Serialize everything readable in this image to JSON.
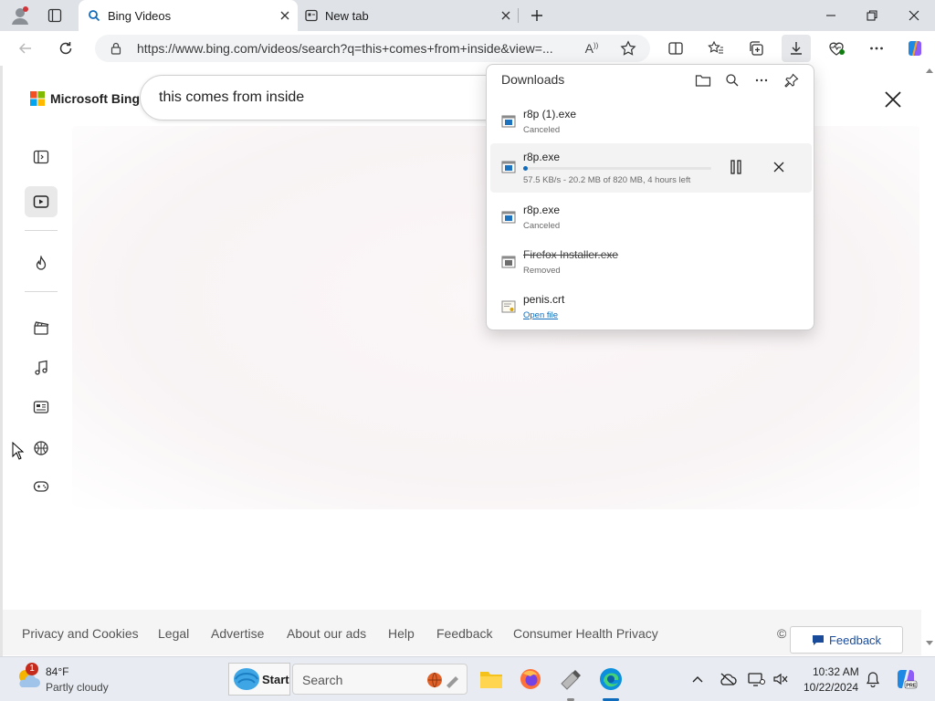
{
  "tabs": [
    {
      "title": "Bing Videos",
      "icon": "search-icon"
    },
    {
      "title": "New tab",
      "icon": "new-tab-page-icon"
    }
  ],
  "address": {
    "url": "https://www.bing.com/videos/search?q=this+comes+from+inside&view=..."
  },
  "page": {
    "logo_text": "Microsoft Bing",
    "search_query": "this comes from inside",
    "footer_links": [
      "Privacy and Cookies",
      "Legal",
      "Advertise",
      "About our ads",
      "Help",
      "Feedback",
      "Consumer Health Privacy"
    ],
    "copyright_glyph": "©",
    "feedback_button": "Feedback"
  },
  "downloads": {
    "title": "Downloads",
    "items": [
      {
        "name": "r8p (1).exe",
        "status": "Canceled"
      },
      {
        "name": "r8p.exe",
        "progress_text": "57.5 KB/s - 20.2 MB of 820 MB, 4 hours left",
        "progress": 0.025
      },
      {
        "name": "r8p.exe",
        "status": "Canceled"
      },
      {
        "name": "Firefox Installer.exe",
        "status": "Removed"
      },
      {
        "name": "penis.crt",
        "link": "Open file"
      }
    ]
  },
  "taskbar": {
    "weather_temp": "84°F",
    "weather_desc": "Partly cloudy",
    "weather_badge": "1",
    "start_label": "Start",
    "search_placeholder": "Search",
    "time": "10:32 AM",
    "date": "10/22/2024"
  },
  "colors": {
    "accent": "#0f6cbd",
    "tabstrip": "#dfe3e8"
  }
}
